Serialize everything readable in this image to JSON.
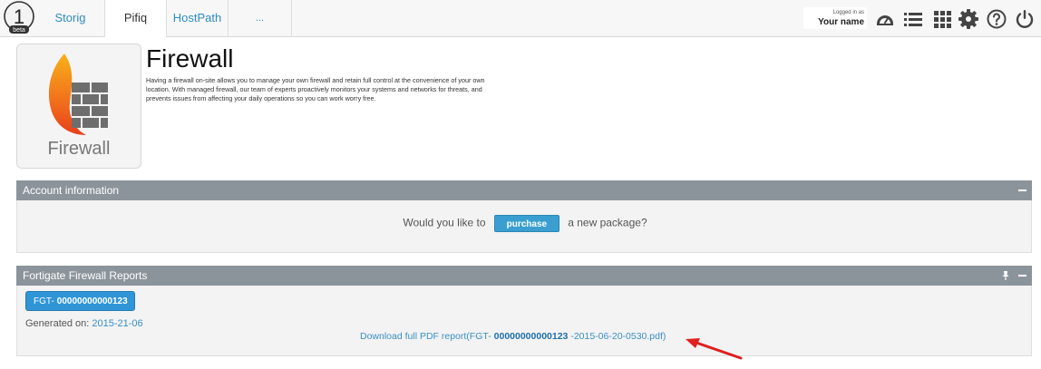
{
  "logo": {
    "number": "1",
    "tag": "beta"
  },
  "nav": {
    "tabs": [
      {
        "label": "Storig"
      },
      {
        "label": "Pifiq"
      },
      {
        "label": "HostPath"
      },
      {
        "label": "..."
      }
    ]
  },
  "user": {
    "caption": "Logged in as",
    "name": "Your name"
  },
  "toolbar_icons": [
    "gauge-icon",
    "list-icon",
    "grid-icon",
    "gear-icon",
    "help-icon",
    "power-icon"
  ],
  "product": {
    "tile_label": "Firewall",
    "title": "Firewall",
    "description": "Having a firewall on-site allows you to manage your own firewall and retain full control at the convenience of your own location. With managed firewall, our team of experts proactively monitors your systems and networks for threats, and prevents issues from affecting your daily operations so you can work worry free."
  },
  "account_panel": {
    "title": "Account information",
    "prompt_before": "Would you like to",
    "button_label": "purchase",
    "prompt_after": "a new package?"
  },
  "reports_panel": {
    "title": "Fortigate Firewall Reports",
    "device_prefix": "FGT-",
    "device_serial": "00000000000123",
    "generated_label": "Generated on:",
    "generated_date": "2015-21-06",
    "link_before": "Download full PDF report(FGT-",
    "link_serial": "00000000000123",
    "link_after": "-2015-06-20-0530.pdf)"
  },
  "colors": {
    "panel_header": "#8c949b",
    "accent_blue": "#2f95d6",
    "link_blue": "#3a8fc6",
    "arrow_red": "#e02020"
  }
}
